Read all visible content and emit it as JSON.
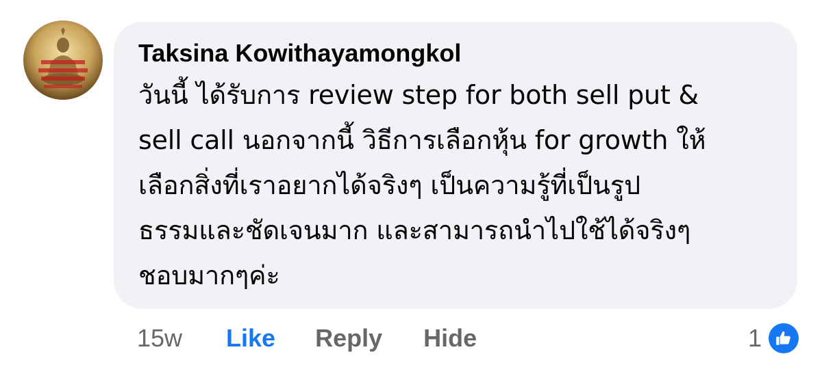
{
  "comment": {
    "avatar_icon": "buddha-avatar-icon",
    "author": "Taksina Kowithayamongkol",
    "text": "วันนี้ ได้รับการ review step for both sell put &\nsell call นอกจากนี้ วิธีการเลือกหุ้น for growth ให้\nเลือกสิ่งที่เราอยากได้จริงๆ เป็นความรู้ที่เป็นรูป\nธรรมและชัดเจนมาก และสามารถนำไปใช้ได้จริงๆ\nชอบมากๆค่ะ",
    "bubble_color": "#f0f2f5"
  },
  "actions": {
    "time": "15w",
    "like_label": "Like",
    "reply_label": "Reply",
    "hide_label": "Hide",
    "like_color": "#1877f2",
    "muted_color": "#65676b"
  },
  "reactions": {
    "count": "1",
    "icon": "thumbs-up-icon",
    "badge_color": "#1877f2"
  }
}
